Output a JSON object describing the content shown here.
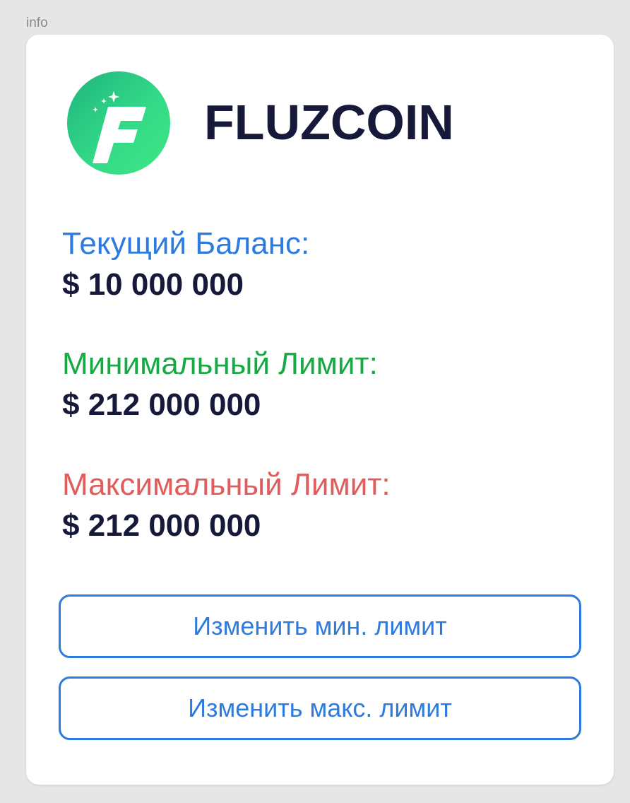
{
  "frame": {
    "label": "info"
  },
  "card": {
    "brand": {
      "name": "FLUZCOIN",
      "logo_icon": "fluzcoin-f-logo-icon",
      "logo_letter": "F"
    },
    "balance": {
      "label": "Текущий Баланс:",
      "value": "$ 10 000 000",
      "label_color": "#2e7be0"
    },
    "min_limit": {
      "label": "Минимальный Лимит:",
      "value": "$ 212 000 000",
      "label_color": "#16a944"
    },
    "max_limit": {
      "label": "Максимальный Лимит:",
      "value": "$ 212 000 000",
      "label_color": "#e25c5c"
    },
    "buttons": {
      "change_min": "Изменить мин. лимит",
      "change_max": "Изменить макс. лимит"
    }
  },
  "colors": {
    "accent": "#2e7be0",
    "text_dark": "#17193b",
    "logo_gradient_start": "#1fb47f",
    "logo_gradient_end": "#3ee684"
  }
}
